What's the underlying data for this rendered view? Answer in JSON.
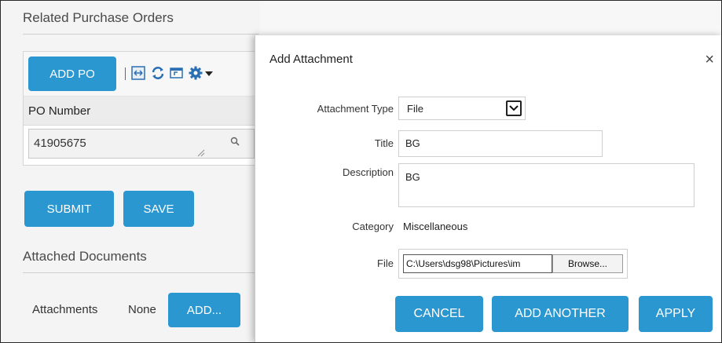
{
  "related_po": {
    "title": "Related Purchase Orders",
    "add_po_label": "ADD PO",
    "column_header": "PO Number",
    "po_value": "41905675"
  },
  "actions": {
    "submit_label": "SUBMIT",
    "save_label": "SAVE"
  },
  "attached_docs": {
    "title": "Attached Documents",
    "attachments_label": "Attachments",
    "attachments_value": "None",
    "add_label": "ADD..."
  },
  "dialog": {
    "title": "Add Attachment",
    "close_symbol": "×",
    "attachment_type_label": "Attachment Type",
    "attachment_type_value": "File",
    "title_label": "Title",
    "title_value": "BG",
    "description_label": "Description",
    "description_value": "BG",
    "category_label": "Category",
    "category_value": "Miscellaneous",
    "file_label": "File",
    "file_path": "C:\\Users\\dsg98\\Pictures\\im",
    "browse_label": "Browse...",
    "cancel_label": "CANCEL",
    "add_another_label": "ADD ANOTHER",
    "apply_label": "APPLY"
  },
  "colors": {
    "primary_button": "#2a97d0",
    "icon_blue": "#2a6fb3"
  },
  "icons": [
    "fit-columns-icon",
    "refresh-icon",
    "restore-icon",
    "gear-icon",
    "caret-down-icon",
    "search-icon",
    "resize-handle-icon",
    "chevron-down-icon"
  ]
}
